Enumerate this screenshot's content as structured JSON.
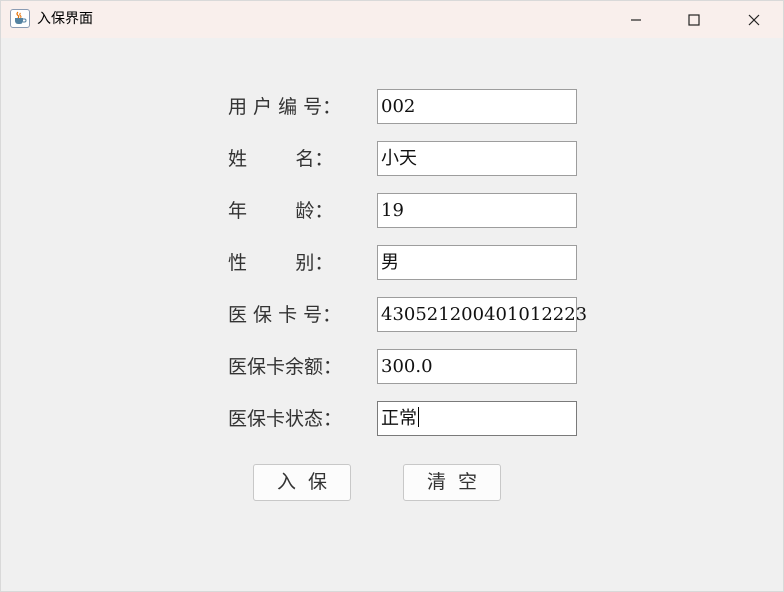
{
  "window": {
    "title": "入保界面",
    "icon": "java-cup-icon",
    "controls": [
      "minimize-icon",
      "maximize-icon",
      "close-icon"
    ]
  },
  "form": {
    "fields": [
      {
        "label": "用 户 编 号：",
        "value": "002"
      },
      {
        "label": "姓        名：",
        "value": "小天"
      },
      {
        "label": "年        龄：",
        "value": "19"
      },
      {
        "label": "性        别：",
        "value": "男"
      },
      {
        "label": "医 保 卡 号：",
        "value": "430521200401012223"
      },
      {
        "label": "医保卡余额：",
        "value": "300.0"
      },
      {
        "label": "医保卡状态：",
        "value": "正常"
      }
    ]
  },
  "buttons": {
    "submit_label": "入  保",
    "clear_label": "清  空"
  },
  "colors": {
    "titlebar_bg": "#f9efec",
    "window_bg": "#f0f0f0",
    "field_border": "#9d9d9d"
  }
}
